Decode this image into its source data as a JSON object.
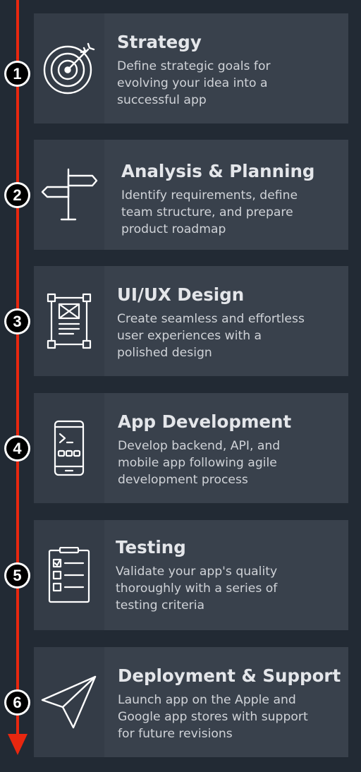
{
  "accent_color": "#e8270f",
  "steps": [
    {
      "number": "1",
      "icon": "target-icon",
      "title": "Strategy",
      "desc_lines": [
        "Define strategic goals for",
        "evolving your idea into a",
        "successful app"
      ]
    },
    {
      "number": "2",
      "icon": "signpost-icon",
      "title": "Analysis & Planning",
      "desc_lines": [
        "Identify requirements, define",
        "team structure, and prepare",
        "product roadmap"
      ]
    },
    {
      "number": "3",
      "icon": "wireframe-icon",
      "title": "UI/UX Design",
      "desc_lines": [
        "Create seamless and effortless",
        "user experiences with a",
        "polished design"
      ]
    },
    {
      "number": "4",
      "icon": "mobile-code-icon",
      "title": "App Development",
      "desc_lines": [
        "Develop backend, API, and",
        "mobile app following agile",
        "development process"
      ]
    },
    {
      "number": "5",
      "icon": "checklist-icon",
      "title": "Testing",
      "desc_lines": [
        "Validate your app's quality",
        "thoroughly with a series of",
        "testing criteria"
      ]
    },
    {
      "number": "6",
      "icon": "paper-plane-icon",
      "title": "Deployment & Support",
      "desc_lines": [
        "Launch app on the Apple and",
        "Google app stores with support",
        "for future revisions"
      ]
    }
  ]
}
